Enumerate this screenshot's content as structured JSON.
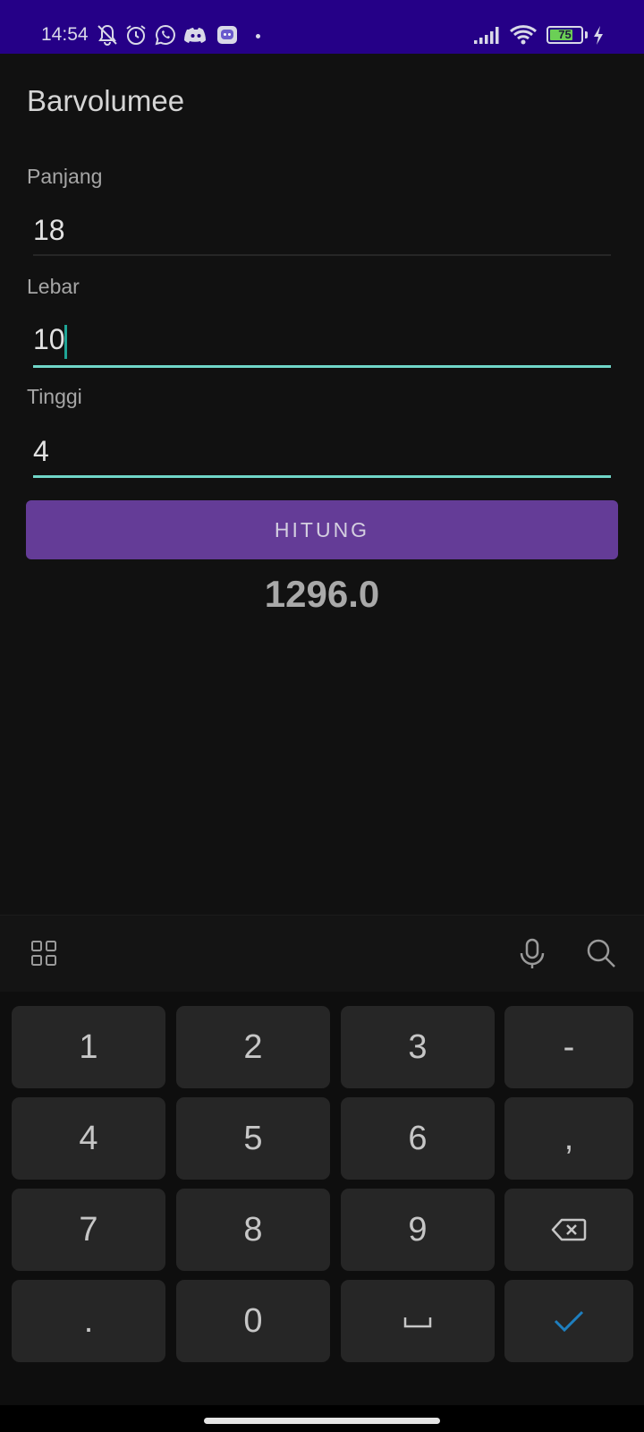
{
  "status_bar": {
    "time": "14:54",
    "battery": "75",
    "battery_fraction": 0.75,
    "icons": [
      "bell-off-icon",
      "alarm-icon",
      "whatsapp-icon",
      "discord-icon",
      "app-notification-icon",
      "signal-icon",
      "wifi-icon",
      "battery-icon",
      "charging-icon"
    ]
  },
  "app": {
    "title": "Barvolumee",
    "fields": [
      {
        "label": "Panjang",
        "value": "18"
      },
      {
        "label": "Lebar",
        "value": "10"
      },
      {
        "label": "Tinggi",
        "value": "4"
      }
    ],
    "button_label": "HITUNG",
    "result": "1296.0"
  },
  "keyboard": {
    "toolbar": [
      "grid-icon",
      "microphone-icon",
      "search-icon"
    ],
    "rows": [
      [
        "1",
        "2",
        "3",
        "-"
      ],
      [
        "4",
        "5",
        "6",
        ","
      ],
      [
        "7",
        "8",
        "9",
        "backspace"
      ],
      [
        ".",
        "0",
        "space",
        "done"
      ]
    ]
  },
  "colors": {
    "status_bar_bg": "#250087",
    "background": "#111111",
    "accent_underline": "#70d6c8",
    "button_bg": "#643c97",
    "key_bg": "#262626",
    "done_check": "#1e7fbf"
  }
}
